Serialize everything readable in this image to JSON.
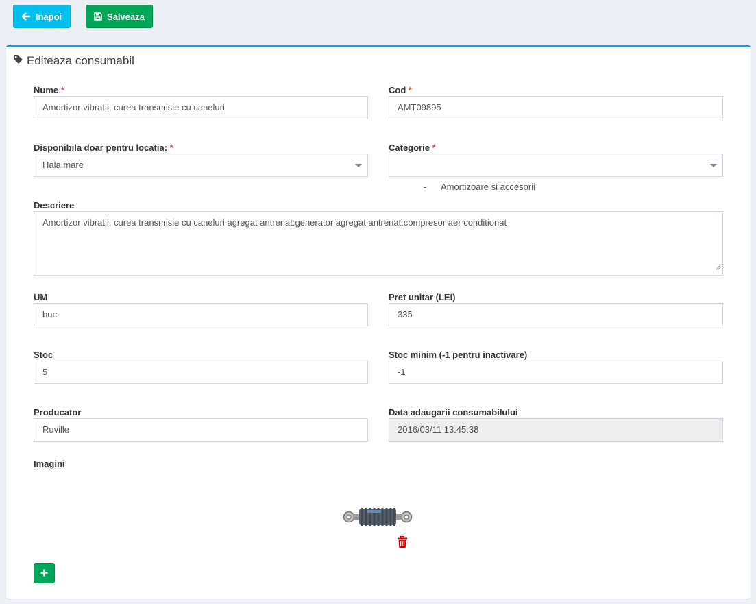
{
  "toolbar": {
    "back_label": "Inapoi",
    "save_label": "Salveaza"
  },
  "form": {
    "title": "Editeaza consumabil",
    "required_mark": "*",
    "nume": {
      "label": "Nume",
      "value": "Amortizor vibratii, curea transmisie cu caneluri"
    },
    "cod": {
      "label": "Cod",
      "value": "AMT09895"
    },
    "locatie": {
      "label": "Disponibila doar pentru locatia:",
      "value": "Hala mare"
    },
    "categorie": {
      "label": "Categorie",
      "value": "-      Amortizoare si accesorii"
    },
    "descriere": {
      "label": "Descriere",
      "value": "Amortizor vibratii, curea transmisie cu caneluri agregat antrenat:generator agregat antrenat:compresor aer conditionat"
    },
    "um": {
      "label": "UM",
      "value": "buc"
    },
    "pret": {
      "label": "Pret unitar (LEI)",
      "value": "335"
    },
    "stoc": {
      "label": "Stoc",
      "value": "5"
    },
    "stoc_minim": {
      "label": "Stoc minim (-1 pentru inactivare)",
      "value": "-1"
    },
    "producator": {
      "label": "Producator",
      "value": "Ruville"
    },
    "data_adaugarii": {
      "label": "Data adaugarii consumabilului",
      "value": "2016/03/11 13:45:38"
    },
    "imagini_label": "Imagini"
  },
  "colors": {
    "primary_border": "#3c8dbc",
    "info": "#00c0ef",
    "success": "#00a65a",
    "danger": "#dd0000"
  },
  "icons": {
    "back": "arrow-left-icon",
    "save": "floppy-disk-icon",
    "title": "tag-icon",
    "delete": "trash-icon",
    "add": "plus-icon"
  }
}
